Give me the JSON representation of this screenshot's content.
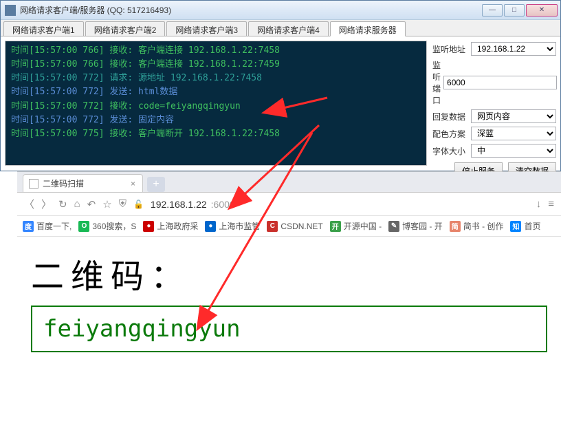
{
  "app": {
    "title": "网络请求客户端/服务器 (QQ: 517216493)"
  },
  "tabs": [
    {
      "label": "网络请求客户端1"
    },
    {
      "label": "网络请求客户端2"
    },
    {
      "label": "网络请求客户端3"
    },
    {
      "label": "网络请求客户端4"
    },
    {
      "label": "网络请求服务器"
    }
  ],
  "console_lines": [
    {
      "text": "时间[15:57:00 766] 接收: 客户端连接 192.168.1.22:7458",
      "cls": "c-green"
    },
    {
      "text": "时间[15:57:00 766] 接收: 客户端连接 192.168.1.22:7459",
      "cls": "c-green"
    },
    {
      "text": "时间[15:57:00 772] 请求: 源地址 192.168.1.22:7458",
      "cls": "c-teal"
    },
    {
      "text": "时间[15:57:00 772] 发送: html数据",
      "cls": "c-blue"
    },
    {
      "text": "时间[15:57:00 772] 接收: code=feiyangqingyun",
      "cls": "c-green"
    },
    {
      "text": "时间[15:57:00 772] 发送: 固定内容",
      "cls": "c-blue"
    },
    {
      "text": "时间[15:57:00 775] 接收: 客户端断开 192.168.1.22:7458",
      "cls": "c-green"
    }
  ],
  "side": {
    "addr_label": "监听地址",
    "addr_value": "192.168.1.22",
    "port_label": "监听端口",
    "port_value": "6000",
    "reply_label": "回复数据",
    "reply_value": "网页内容",
    "theme_label": "配色方案",
    "theme_value": "深蓝",
    "font_label": "字体大小",
    "font_value": "中",
    "btn_stop": "停止服务",
    "btn_clear": "清空数据"
  },
  "browser": {
    "tab_title": "二维码扫描",
    "url_host": "192.168.1.22",
    "url_port": ":6000",
    "bookmarks": [
      {
        "label": "百度一下,",
        "color": "#3385ff",
        "icon": "度"
      },
      {
        "label": "360搜索，S",
        "color": "#19b955",
        "icon": "O"
      },
      {
        "label": "上海政府采",
        "color": "#c00",
        "icon": "●"
      },
      {
        "label": "上海市监管",
        "color": "#06c",
        "icon": "●"
      },
      {
        "label": "CSDN.NET",
        "color": "#c9302c",
        "icon": "C"
      },
      {
        "label": "开源中国 - ",
        "color": "#3aa04a",
        "icon": "开"
      },
      {
        "label": "博客园 - 开",
        "color": "#666",
        "icon": "✎"
      },
      {
        "label": "简书 - 创作",
        "color": "#e7846b",
        "icon": "简"
      },
      {
        "label": "首页",
        "color": "#0084ff",
        "icon": "知"
      }
    ],
    "page_heading": "二维码：",
    "page_value": "feiyangqingyun"
  }
}
